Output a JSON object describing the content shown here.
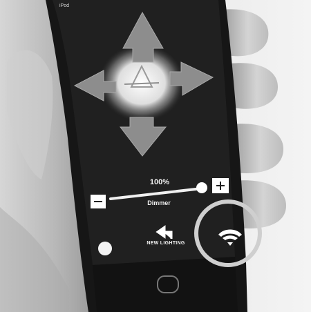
{
  "status_bar": {
    "device": "iPod"
  },
  "dimmer": {
    "percent": "100%",
    "label": "Dimmer",
    "level": 1.0
  },
  "nav": {
    "label": "NEW LIGHTING"
  },
  "icons": [
    "arrow-up-icon",
    "arrow-down-icon",
    "arrow-left-icon",
    "arrow-right-icon",
    "minus-icon",
    "plus-icon",
    "back-arrow-icon",
    "wifi-icon",
    "home-button-icon"
  ],
  "colors": {
    "screen": "#1c1c1c",
    "hand": "#c9c9c9",
    "arrow": "#8d8d8d",
    "highlight": "#ffffff"
  }
}
